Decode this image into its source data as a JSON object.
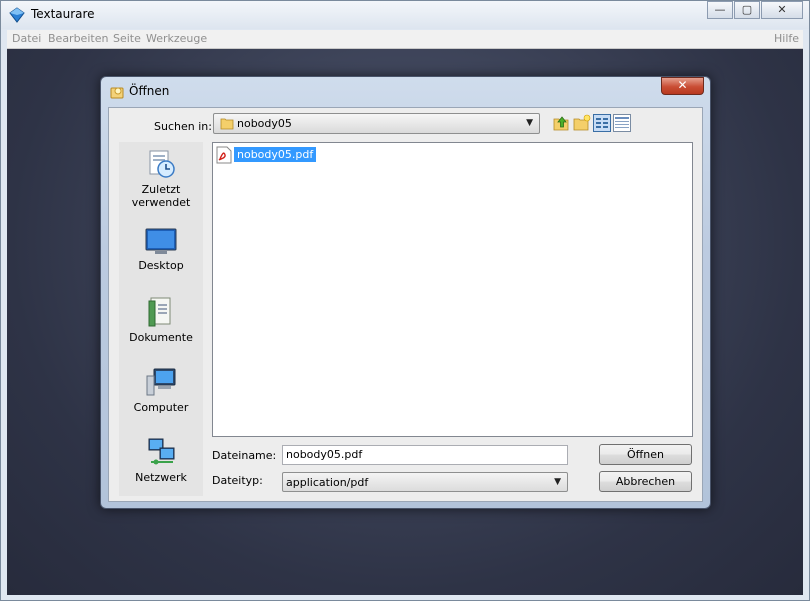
{
  "app": {
    "title": "Textaurare"
  },
  "window_buttons": {
    "minimize": "—",
    "maximize": "▢",
    "close": "✕"
  },
  "menu": {
    "items": [
      "Datei",
      "Bearbeiten",
      "Seite",
      "Werkzeuge"
    ],
    "help": "Hilfe"
  },
  "dialog": {
    "title": "Öffnen",
    "close_glyph": "✕",
    "look_in_label": "Suchen in:",
    "look_in_value": "nobody05",
    "places": [
      "Zuletzt verwendet",
      "Desktop",
      "Dokumente",
      "Computer",
      "Netzwerk"
    ],
    "files": [
      {
        "name": "nobody05.pdf",
        "icon": "pdf-icon",
        "selected": true
      }
    ],
    "filename_label": "Dateiname:",
    "filename_value": "nobody05.pdf",
    "filetype_label": "Dateityp:",
    "filetype_value": "application/pdf",
    "open_button": "Öffnen",
    "cancel_button": "Abbrechen"
  },
  "colors": {
    "selection": "#3399ff",
    "workspace": "#2e3346",
    "close_red": "#c94d34"
  }
}
